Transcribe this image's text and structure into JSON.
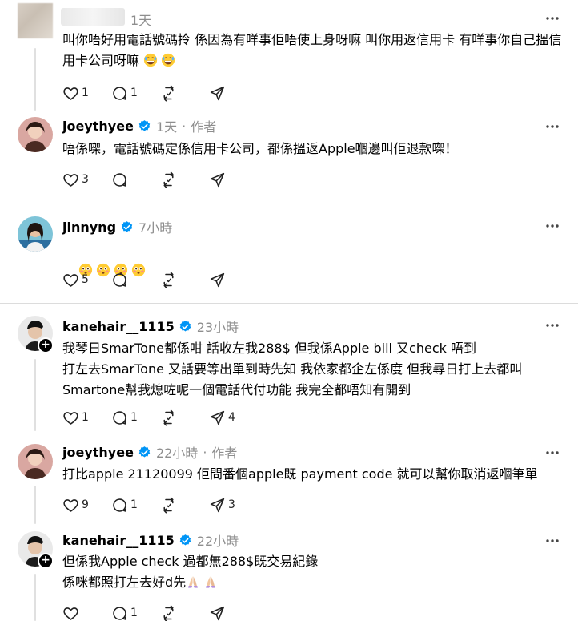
{
  "posts": [
    {
      "username": "",
      "time": "1天",
      "author_tag": "",
      "text": "叫你唔好用電話號碼拎 係因為有咩事佢唔使上身呀嘛 叫你用返信用卡 有咩事你自己搵信用卡公司呀嘛",
      "emojis": [
        "grinning-sweat",
        "grinning-sweat"
      ],
      "counts": {
        "likes": "1",
        "comments": "1",
        "reposts": "",
        "shares": ""
      }
    },
    {
      "username": "joeythyee",
      "time": "1天",
      "author_tag": "作者",
      "text": "唔係㗎，電話號碼定係信用卡公司，都係搵返Apple嗰邊叫佢退款㗎！",
      "counts": {
        "likes": "3",
        "comments": "",
        "reposts": "",
        "shares": ""
      }
    },
    {
      "username": "jinnyng",
      "time": "7小時",
      "author_tag": "",
      "text": "",
      "emojis": [
        "flushed",
        "flushed",
        "flushed",
        "flushed"
      ],
      "counts": {
        "likes": "5",
        "comments": "",
        "reposts": "",
        "shares": ""
      }
    },
    {
      "username": "kanehair__1115",
      "time": "23小時",
      "author_tag": "",
      "text": "我琴日SmarTone都係咁 話收左我288$ 但我係Apple bill 又check 唔到\n打左去SmarTone 又話要等出單到時先知 我依家都企左係度 但我尋日打上去都叫\nSmartone幫我熄咗呢一個電話代付功能 我完全都唔知有開到",
      "counts": {
        "likes": "1",
        "comments": "1",
        "reposts": "",
        "shares": "4"
      }
    },
    {
      "username": "joeythyee",
      "time": "22小時",
      "author_tag": "作者",
      "text": "打比apple 21120099 佢問番個apple既 payment code 就可以幫你取消返嗰筆單",
      "counts": {
        "likes": "9",
        "comments": "1",
        "reposts": "",
        "shares": "3"
      }
    },
    {
      "username": "kanehair__1115",
      "time": "22小時",
      "author_tag": "",
      "text": "但係我Apple check 過都無288$既交易紀錄\n係咪都照打左去好d先",
      "emojis": [
        "praying-hands",
        "praying-hands"
      ],
      "counts": {
        "likes": "",
        "comments": "1",
        "reposts": "",
        "shares": ""
      }
    }
  ],
  "colors": {
    "verified": "#0095f6",
    "secondary_text": "#8e8e8e",
    "divider": "#dcdcdc"
  },
  "icons": [
    "heart-icon",
    "comment-icon",
    "repost-icon",
    "share-icon",
    "more-icon",
    "verified-badge-icon",
    "follow-plus-icon"
  ]
}
